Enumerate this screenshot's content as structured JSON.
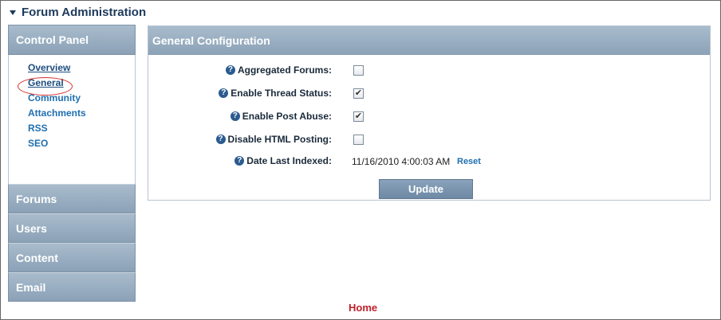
{
  "page": {
    "title": "Forum Administration"
  },
  "sidebar": {
    "control_panel": {
      "title": "Control Panel",
      "links": [
        {
          "label": "Overview"
        },
        {
          "label": "General"
        },
        {
          "label": "Community"
        },
        {
          "label": "Attachments"
        },
        {
          "label": "RSS"
        },
        {
          "label": "SEO"
        }
      ]
    },
    "sections": [
      {
        "label": "Forums"
      },
      {
        "label": "Users"
      },
      {
        "label": "Content"
      },
      {
        "label": "Email"
      }
    ]
  },
  "general_config": {
    "title": "General Configuration",
    "help_glyph": "?",
    "settings": [
      {
        "label": "Aggregated Forums:",
        "checked": false
      },
      {
        "label": "Enable Thread Status:",
        "checked": true
      },
      {
        "label": "Enable Post Abuse:",
        "checked": true
      },
      {
        "label": "Disable HTML Posting:",
        "checked": false
      }
    ],
    "date_last_indexed": {
      "label": "Date Last Indexed:",
      "value": "11/16/2010 4:00:03 AM",
      "reset_label": "Reset"
    },
    "update_label": "Update"
  },
  "footer": {
    "home_label": "Home"
  },
  "colors": {
    "header_blue": "#8ba1b6",
    "link_blue": "#1f6fb0",
    "home_red": "#c0202a",
    "highlight_oval": "#d9302b"
  }
}
